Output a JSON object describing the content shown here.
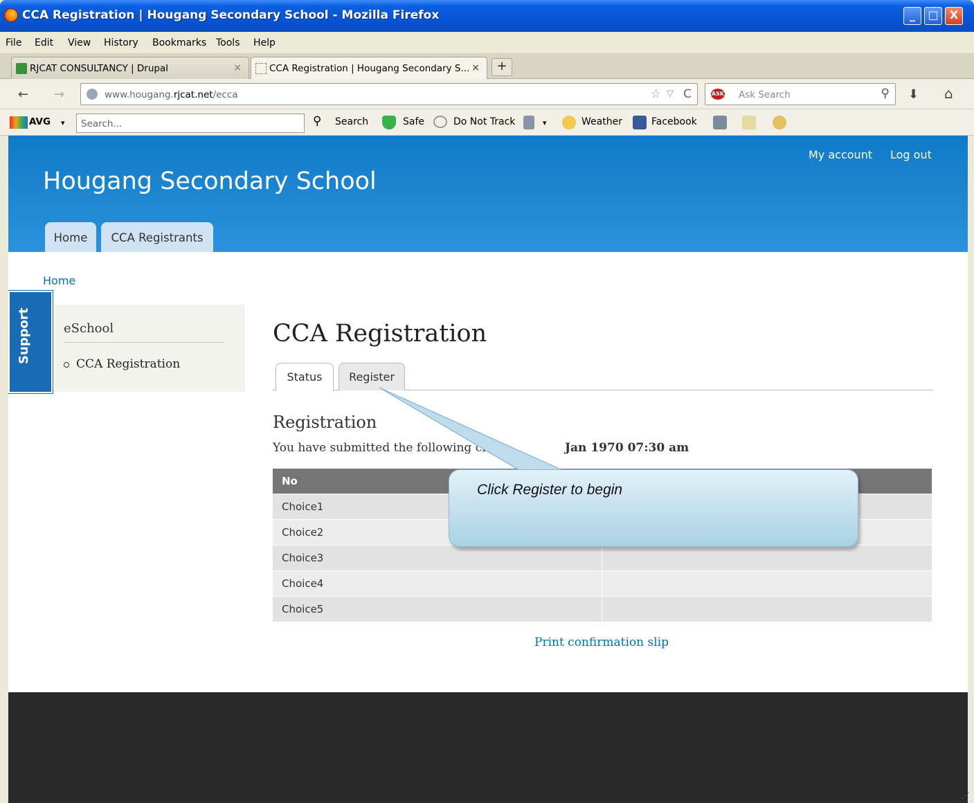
{
  "window": {
    "title": "CCA Registration | Hougang Secondary School - Mozilla Firefox",
    "controls": [
      "_",
      "□",
      "X"
    ]
  },
  "menu": [
    "File",
    "Edit",
    "View",
    "History",
    "Bookmarks",
    "Tools",
    "Help"
  ],
  "tabs": [
    {
      "label": "RJCAT CONSULTANCY | Drupal",
      "close": "×"
    },
    {
      "label": "CCA Registration | Hougang Secondary S...",
      "close": "×"
    }
  ],
  "new_tab": "+",
  "nav": {
    "url_host": "www.hougang.",
    "url_domain": "rjcat.net",
    "url_path": "/ecca",
    "search_placeholder": "Ask Search",
    "back": "←",
    "forward": "→",
    "star": "☆",
    "dropdown": "▽",
    "reload": "C",
    "search_icon": "⚲",
    "download": "⬇",
    "home": "⌂",
    "ask_logo": "ASK"
  },
  "avg": {
    "brand": "AVG",
    "dropdown": "▾",
    "search_placeholder": "Search...",
    "search_label": "Search",
    "safe_label": "Safe",
    "dnt_label": "Do Not Track",
    "weather_label": "Weather",
    "facebook_label": "Facebook"
  },
  "site": {
    "name": "Hougang Secondary School",
    "my_account": "My account",
    "log_out": "Log out",
    "main_tabs": [
      "Home",
      "CCA Registrants"
    ],
    "breadcrumb": "Home",
    "support": "Support"
  },
  "sidebar": {
    "title": "eSchool",
    "link": "CCA Registration"
  },
  "content": {
    "title": "CCA Registration",
    "tabs": [
      "Status",
      "Register"
    ],
    "section_title": "Registration",
    "submitted_text": "You have submitted the following ch",
    "submitted_date": "Jan 1970 07:30 am",
    "table_header": "No",
    "rows": [
      "Choice1",
      "Choice2",
      "Choice3",
      "Choice4",
      "Choice5"
    ],
    "print_link": "Print confirmation slip"
  },
  "callout": {
    "text": "Click Register to begin"
  },
  "colors": {
    "header_blue": "#0f7ac7",
    "link_blue": "#0071b3",
    "footer": "#292929"
  }
}
